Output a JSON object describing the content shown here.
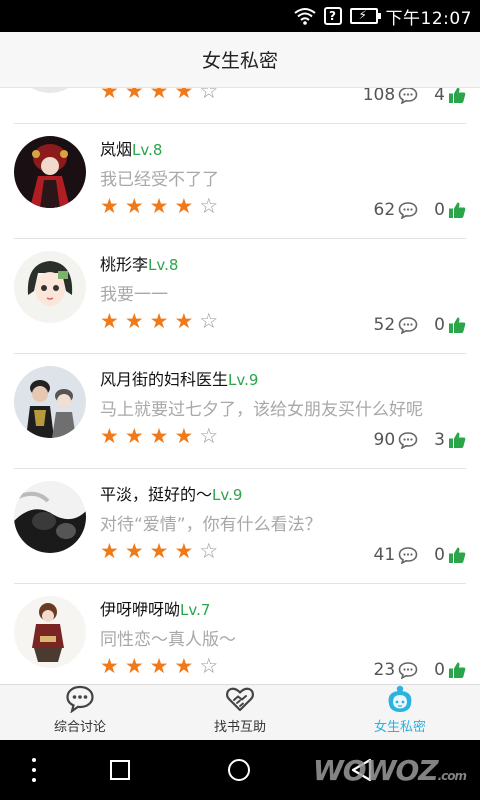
{
  "status_bar": {
    "sim_label": "?",
    "time": "下午12:07"
  },
  "header": {
    "title": "女生私密"
  },
  "colors": {
    "star": "#f07a1a",
    "level": "#2aa54a",
    "like": "#2aa54a",
    "active_tab": "#2ab3e0"
  },
  "posts": [
    {
      "name": "",
      "level": "",
      "message": "",
      "stars": 4,
      "max_stars": 5,
      "comments": "108",
      "likes": "4"
    },
    {
      "name": "岚烟",
      "level": "Lv.8",
      "message": "我已经受不了了",
      "stars": 4,
      "max_stars": 5,
      "comments": "62",
      "likes": "0"
    },
    {
      "name": "桃形李",
      "level": "Lv.8",
      "message": "我要一一",
      "stars": 4,
      "max_stars": 5,
      "comments": "52",
      "likes": "0"
    },
    {
      "name": "风月街的妇科医生",
      "level": "Lv.9",
      "message": "马上就要过七夕了，该给女朋友买什么好呢",
      "stars": 4,
      "max_stars": 5,
      "comments": "90",
      "likes": "3"
    },
    {
      "name": "平淡，挺好的～",
      "level": "Lv.9",
      "message": "对待“爱情”，你有什么看法？",
      "stars": 4,
      "max_stars": 5,
      "comments": "41",
      "likes": "0"
    },
    {
      "name": "伊呀咿呀呦",
      "level": "Lv.7",
      "message": "同性恋～真人版～",
      "stars": 4,
      "max_stars": 5,
      "comments": "23",
      "likes": "0"
    }
  ],
  "tabs": [
    {
      "label": "综合讨论",
      "icon": "chat-bubble-icon",
      "active": false
    },
    {
      "label": "找书互助",
      "icon": "handshake-heart-icon",
      "active": false
    },
    {
      "label": "女生私密",
      "icon": "girl-face-icon",
      "active": true
    }
  ],
  "watermark": {
    "text": "WOWOZ",
    "suffix": ".com"
  }
}
